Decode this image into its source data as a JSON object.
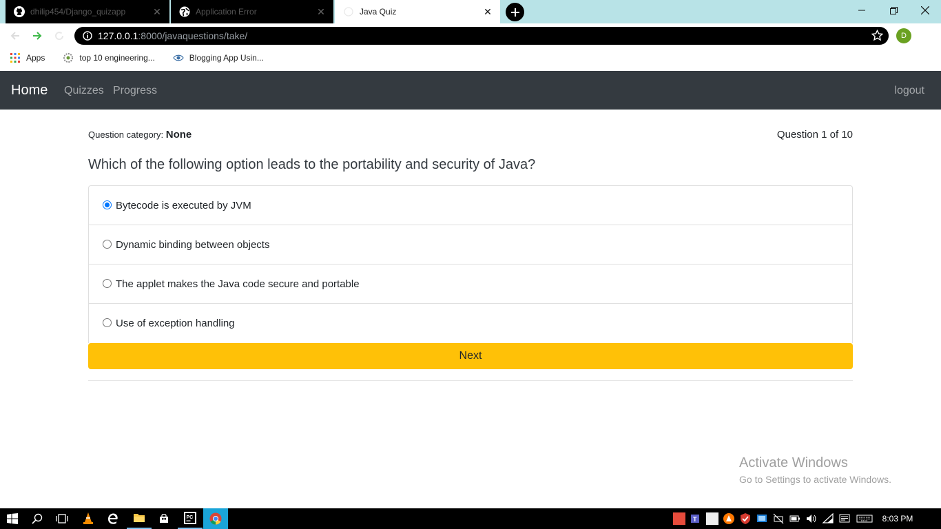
{
  "browser": {
    "tabs": [
      {
        "title": "dhilip454/Django_quizapp",
        "icon": "github-icon",
        "active": false
      },
      {
        "title": "Application Error",
        "icon": "globe-icon",
        "active": false
      },
      {
        "title": "Java Quiz",
        "icon": "page-icon",
        "active": true
      }
    ],
    "url_host": "127.0.0.1",
    "url_path": ":8000/javaquestions/take/",
    "profile_initial": "D",
    "bookmarks": [
      {
        "label": "Apps",
        "icon": "apps-grid-icon"
      },
      {
        "label": "top 10 engineering...",
        "icon": "site-icon"
      },
      {
        "label": "Blogging App Usin...",
        "icon": "eye-logo-icon"
      }
    ]
  },
  "navbar": {
    "brand": "Home",
    "links": [
      "Quizzes",
      "Progress"
    ],
    "logout": "logout"
  },
  "quiz": {
    "category_label": "Question category:",
    "category_value": "None",
    "progress": "Question 1 of 10",
    "question": "Which of the following option leads to the portability and security of Java?",
    "options": [
      {
        "label": "Bytecode is executed by JVM",
        "selected": true
      },
      {
        "label": "Dynamic binding between objects",
        "selected": false
      },
      {
        "label": "The applet makes the Java code secure and portable",
        "selected": false
      },
      {
        "label": "Use of exception handling",
        "selected": false
      }
    ],
    "next_label": "Next"
  },
  "watermark": {
    "line1": "Activate Windows",
    "line2": "Go to Settings to activate Windows."
  },
  "taskbar": {
    "clock": "8:03 PM"
  },
  "colors": {
    "navbar_bg": "#343a40",
    "next_button": "#ffc107",
    "tabstrip": "#b8e3e7",
    "radio_selected": "#0075ff"
  }
}
